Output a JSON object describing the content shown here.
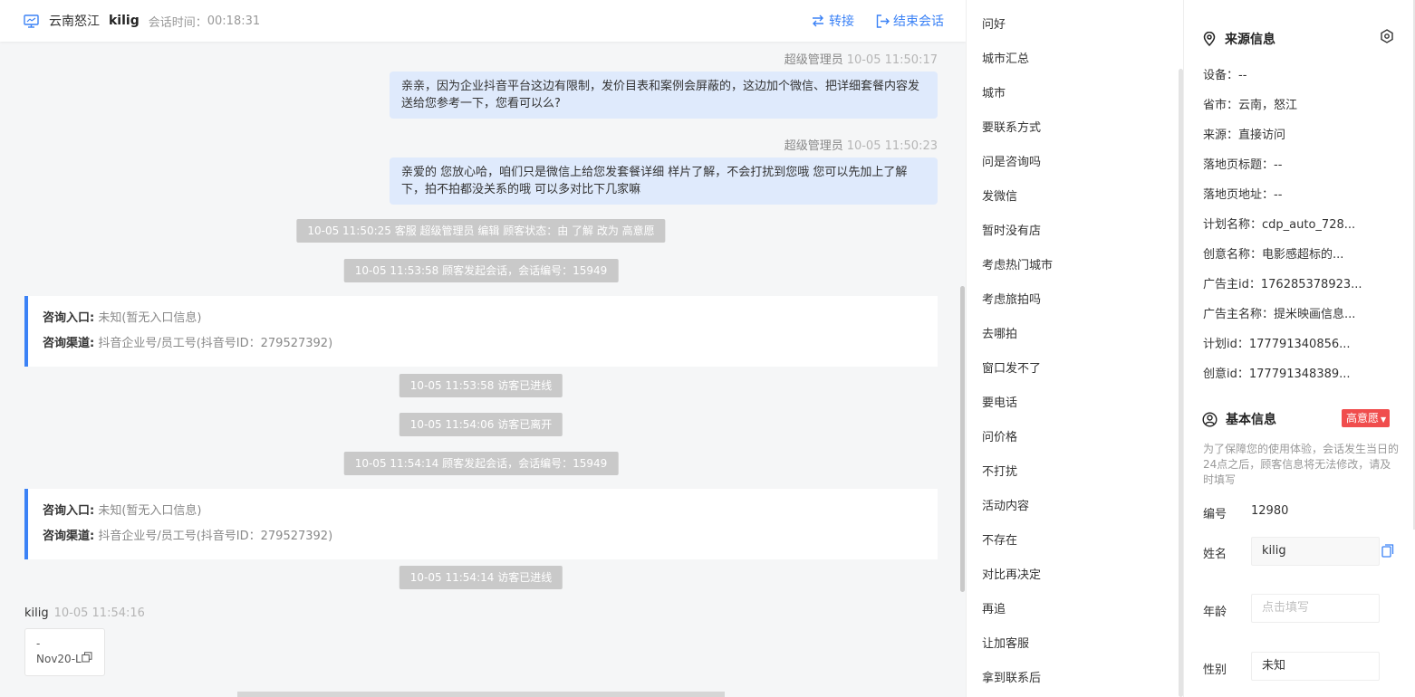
{
  "header": {
    "location": "云南怒江",
    "user": "kilig",
    "time_label": "会话时间：",
    "time": "00:18:31",
    "transfer_label": "转接",
    "end_label": "结束会话"
  },
  "messages": {
    "agent1": {
      "sender": "超级管理员",
      "time": "10-05 11:50:17",
      "text": "亲亲，因为企业抖音平台这边有限制，发价目表和案例会屏蔽的，这边加个微信、把详细套餐内容发送给您参考一下，您看可以么?"
    },
    "agent2": {
      "sender": "超级管理员",
      "time": "10-05 11:50:23",
      "text": "亲爱的 您放心哈，咱们只是微信上给您发套餐详细 样片了解，不会打扰到您哦 您可以先加上了解下，拍不拍都没关系的哦 可以多对比下几家嘛"
    },
    "sys1": "10-05 11:50:25 客服 超级管理员 编辑 顾客状态：由 了解 改为 高意愿",
    "sys2": "10-05 11:53:58 顾客发起会话，会话编号：15949",
    "card1": {
      "entry_label": "咨询入口:",
      "entry_value": "未知(暂无入口信息)",
      "channel_label": "咨询渠道:",
      "channel_value": "抖音企业号/员工号(抖音号ID：279527392)"
    },
    "sys3": "10-05 11:53:58 访客已进线",
    "sys4": "10-05 11:54:06 访客已离开",
    "sys5": "10-05 11:54:14 顾客发起会话，会话编号：15949",
    "card2": {
      "entry_label": "咨询入口:",
      "entry_value": "未知(暂无入口信息)",
      "channel_label": "咨询渠道:",
      "channel_value": "抖音企业号/员工号(抖音号ID：279527392)"
    },
    "sys6": "10-05 11:54:14 访客已进线",
    "visitor": {
      "name": "kilig",
      "time": "10-05 11:54:16",
      "line1": "-",
      "line2": "Nov20-L"
    }
  },
  "quick_replies": [
    "问好",
    "城市汇总",
    "城市",
    "要联系方式",
    "问是咨询吗",
    "发微信",
    "暂时没有店",
    "考虑热门城市",
    "考虑旅拍吗",
    "去哪拍",
    "窗口发不了",
    "要电话",
    "问价格",
    "不打扰",
    "活动内容",
    "不存在",
    "对比再决定",
    "再追",
    "让加客服",
    "拿到联系后"
  ],
  "source_info": {
    "title": "来源信息",
    "rows": [
      {
        "label": "设备：",
        "value": "--"
      },
      {
        "label": "省市：",
        "value": "云南，怒江"
      },
      {
        "label": "来源：",
        "value": "直接访问"
      },
      {
        "label": "落地页标题：",
        "value": "--"
      },
      {
        "label": "落地页地址：",
        "value": "--"
      },
      {
        "label": "计划名称：",
        "value": "cdp_auto_728..."
      },
      {
        "label": "创意名称：",
        "value": "电影感超标的..."
      },
      {
        "label": "广告主id：",
        "value": "176285378923..."
      },
      {
        "label": "广告主名称：",
        "value": "提米映画信息..."
      },
      {
        "label": "计划id：",
        "value": "177791340856..."
      },
      {
        "label": "创意id：",
        "value": "177791348389..."
      }
    ]
  },
  "basic_info": {
    "title": "基本信息",
    "intent_badge": "高意愿",
    "note": "为了保障您的使用体验，会话发生当日的24点之后，顾客信息将无法修改，请及时填写",
    "id_label": "编号",
    "id_value": "12980",
    "name_label": "姓名",
    "name_value": "kilig",
    "age_label": "年龄",
    "age_placeholder": "点击填写",
    "gender_label": "性别",
    "gender_value": "未知"
  },
  "colors": {
    "accent": "#3b82f6",
    "agent_bubble": "#dfeafc",
    "badge": "#f04d4d",
    "system_pill": "#c9c9c9"
  }
}
